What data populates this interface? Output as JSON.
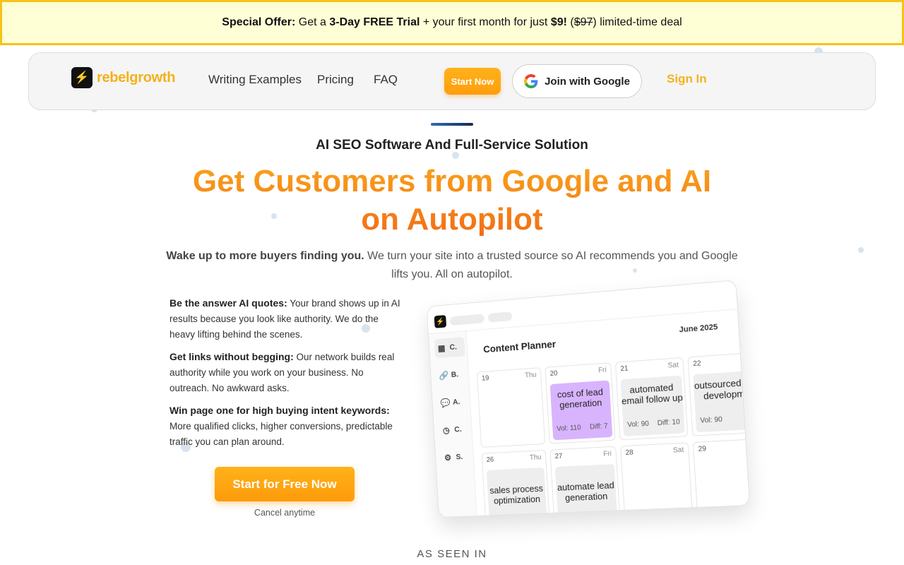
{
  "promo": {
    "label": "Special Offer:",
    "text1": " Get a ",
    "trial": "3-Day FREE Trial",
    "text2": " + your first month for just ",
    "price": "$9!",
    "text3": " (",
    "old_price": "$97",
    "text4": ") limited-time deal",
    "border_color": "#f7c21a",
    "bg_color": "#ffffd6"
  },
  "nav": {
    "logo_text": "rebelgrowth",
    "logo_icon": "lightning-icon",
    "links": [
      "Writing Examples",
      "Pricing",
      "FAQ"
    ],
    "start_label": "Start Now",
    "google_label": "Join with Google",
    "google_icon": "google-g-icon",
    "sign_in_label": "Sign In"
  },
  "hero": {
    "eyebrow": "AI SEO Software And Full-Service Solution",
    "headline_line1": "Get Customers from Google and AI",
    "headline_line2": "on Autopilot",
    "sub_bold": "Wake up to more buyers finding you.",
    "sub_text": " We turn your site into a trusted source so AI recommends you and Google lifts you. All on autopilot."
  },
  "features": [
    {
      "title": "Be the answer AI quotes:",
      "text": " Your brand shows up in AI results because you look like authority. We do the heavy lifting behind the scenes."
    },
    {
      "title": "Get links without begging:",
      "text": " Our network builds real authority while you work on your business. No outreach. No awkward asks."
    },
    {
      "title": "Win page one for high buying intent keywords:",
      "text": " More qualified clicks, higher conversions, predictable traffic you can plan around."
    }
  ],
  "cta": {
    "label": "Start for Free Now",
    "note": "Cancel anytime"
  },
  "mockup": {
    "title": "Content Planner",
    "month": "June 2025",
    "sidebar": [
      {
        "icon": "calendar-icon",
        "glyph": "▦",
        "label": "C."
      },
      {
        "icon": "link-icon",
        "glyph": "🔗",
        "label": "B."
      },
      {
        "icon": "chat-icon",
        "glyph": "💬",
        "label": "A."
      },
      {
        "icon": "clock-icon",
        "glyph": "◷",
        "label": "C."
      },
      {
        "icon": "gear-icon",
        "glyph": "⚙",
        "label": "S."
      }
    ],
    "days": [
      {
        "num": "19",
        "name": "Thu",
        "card": null
      },
      {
        "num": "20",
        "name": "Fri",
        "card": {
          "text": "cost of lead generation",
          "vol": "Vol: 110",
          "diff": "Diff: 7",
          "highlight": true
        }
      },
      {
        "num": "21",
        "name": "Sat",
        "card": {
          "text": "automated email follow up",
          "vol": "Vol: 90",
          "diff": "Diff: 10",
          "highlight": false
        }
      },
      {
        "num": "22",
        "name": "",
        "card": {
          "text": "outsourced sales development",
          "vol": "Vol: 90",
          "diff": "D",
          "highlight": false
        }
      },
      {
        "num": "26",
        "name": "Thu",
        "card": {
          "text": "sales process optimization",
          "vol": "",
          "diff": "",
          "highlight": false
        }
      },
      {
        "num": "27",
        "name": "Fri",
        "card": {
          "text": "automate lead generation",
          "vol": "",
          "diff": "",
          "highlight": false
        }
      },
      {
        "num": "28",
        "name": "Sat",
        "card": null
      },
      {
        "num": "29",
        "name": "",
        "card": null
      }
    ]
  },
  "seen_in": "AS SEEN IN"
}
